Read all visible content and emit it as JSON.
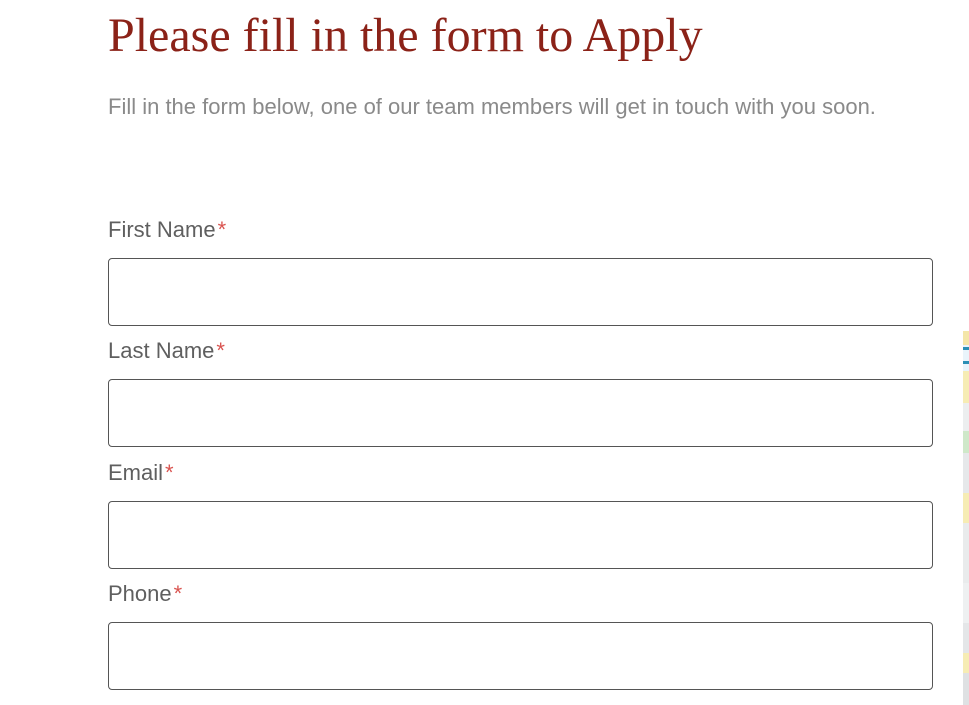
{
  "header": {
    "title": "Please fill in the form to Apply",
    "intro": "Fill in the form below, one of our team members will get in touch with you soon."
  },
  "form": {
    "required_marker": "*",
    "fields": [
      {
        "label": "First Name",
        "value": "",
        "placeholder": ""
      },
      {
        "label": "Last Name",
        "value": "",
        "placeholder": ""
      },
      {
        "label": "Email",
        "value": "",
        "placeholder": ""
      },
      {
        "label": "Phone",
        "value": "",
        "placeholder": ""
      }
    ]
  },
  "colors": {
    "title": "#8b2218",
    "intro_text": "#8a8a8a",
    "label_text": "#5f5f5f",
    "required_marker": "#d9534f",
    "input_border": "#555555",
    "background": "#ffffff"
  }
}
